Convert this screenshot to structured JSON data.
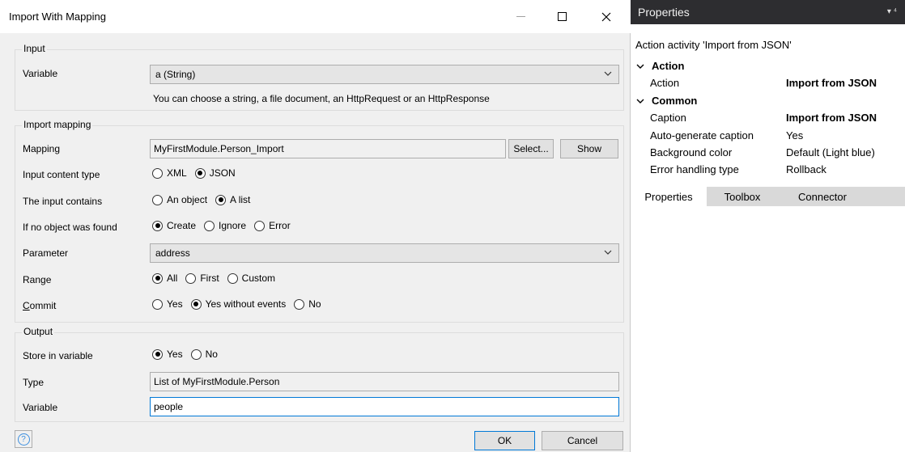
{
  "dialog": {
    "title": "Import With Mapping",
    "input": {
      "legend": "Input",
      "variable_label": "Variable",
      "variable_value": "a (String)",
      "hint": "You can choose a string, a file document, an HttpRequest or an HttpResponse"
    },
    "import_mapping": {
      "legend": "Import mapping",
      "mapping_label": "Mapping",
      "mapping_value": "MyFirstModule.Person_Import",
      "select_button": "Select...",
      "show_button": "Show",
      "content_type_label": "Input content type",
      "content_type_options": [
        "XML",
        "JSON"
      ],
      "input_contains_label": "The input contains",
      "input_contains_options": [
        "An object",
        "A list"
      ],
      "no_object_label": "If no object was found",
      "no_object_options": [
        "Create",
        "Ignore",
        "Error"
      ],
      "parameter_label": "Parameter",
      "parameter_value": "address",
      "range_label": "Range",
      "range_options": [
        "All",
        "First",
        "Custom"
      ],
      "commit_label_first": "C",
      "commit_label_rest": "ommit",
      "commit_options": [
        "Yes",
        "Yes without events",
        "No"
      ]
    },
    "output": {
      "legend": "Output",
      "store_label": "Store in variable",
      "store_options": [
        "Yes",
        "No"
      ],
      "type_label": "Type",
      "type_value": "List of MyFirstModule.Person",
      "variable_label": "Variable",
      "variable_value": "people"
    },
    "footer": {
      "help_glyph": "?",
      "ok_button": "OK",
      "cancel_button": "Cancel"
    }
  },
  "properties": {
    "title": "Properties",
    "header_controls": "▾ ⁴",
    "subtitle": "Action activity 'Import from JSON'",
    "categories": [
      {
        "name": "Action",
        "rows": [
          {
            "key": "Action",
            "value": "Import from JSON"
          }
        ]
      },
      {
        "name": "Common",
        "rows": [
          {
            "key": "Caption",
            "value": "Import from JSON"
          },
          {
            "key": "Auto-generate caption",
            "value": "Yes"
          },
          {
            "key": "Background color",
            "value": "Default (Light blue)"
          },
          {
            "key": "Error handling type",
            "value": "Rollback"
          }
        ]
      }
    ],
    "tabs": [
      "Properties",
      "Toolbox",
      "Connector"
    ]
  },
  "colors": {
    "dialog_bg": "#f0f0f0",
    "pane_header": "#2d2d30",
    "focus_border": "#0078d7"
  }
}
